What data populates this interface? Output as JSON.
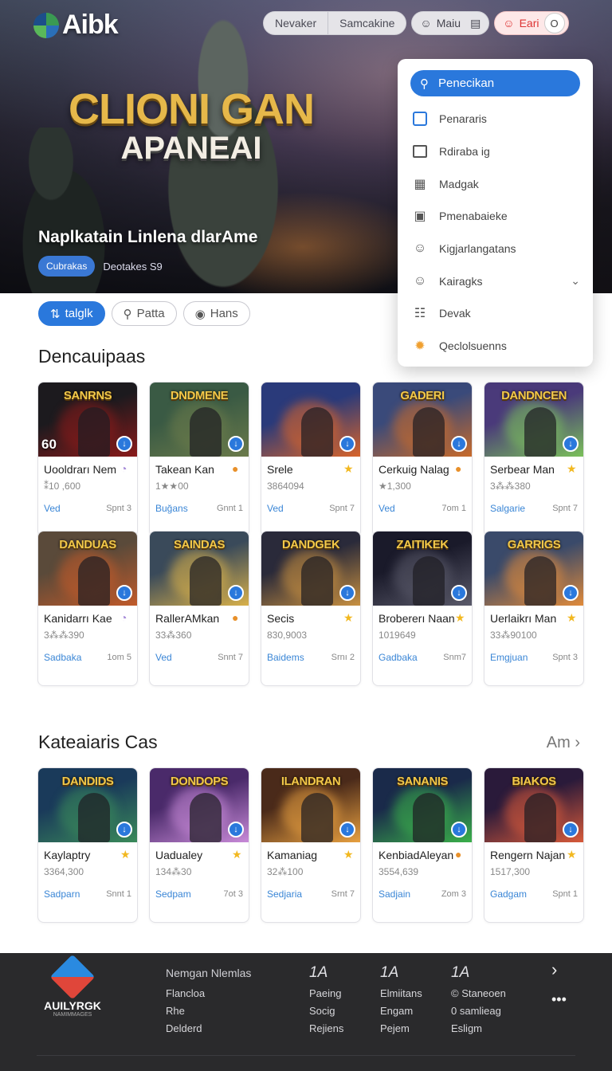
{
  "brand": {
    "name": "Aibk"
  },
  "top_nav": {
    "segment": [
      "Nevaker",
      "Samcakine"
    ],
    "user_pill": "Maiu",
    "action_pill": "Eari",
    "action_circle": "O"
  },
  "hero": {
    "title_line1": "CLIONI GAN",
    "title_line2": "APANEAI",
    "subtitle": "Naplkatain Linlena dlarAme",
    "tag": "Cubrakas",
    "meta": "Deotakes S9"
  },
  "dropdown": {
    "search": "Penecikan",
    "items": [
      {
        "label": "Penararis",
        "icon": "checkbox-icon"
      },
      {
        "label": "Rdiraba ig",
        "icon": "image-icon"
      },
      {
        "label": "Madgak",
        "icon": "grid-icon"
      },
      {
        "label": "Pmenabaieke",
        "icon": "frame-icon"
      },
      {
        "label": "Kigjarlangatans",
        "icon": "person-icon"
      },
      {
        "label": "Kairagks",
        "icon": "person-icon",
        "chevron": "⌄"
      },
      {
        "label": "Devak",
        "icon": "calendar-icon"
      },
      {
        "label": "Qeclolsuenns",
        "icon": "badge-icon"
      }
    ]
  },
  "chips": [
    "talglk",
    "Patta",
    "Hans"
  ],
  "sections": {
    "first_title": "Dencauipaas",
    "second_title": "Kateaiaris Cas",
    "second_more": "Am"
  },
  "row1": [
    {
      "logo": "SANRNS",
      "name": "Uooldrarı Nem",
      "count": "⁑10 ,600",
      "genre": "Ved",
      "date": "Spnt 3",
      "rate": "◔",
      "num": "60",
      "colors": [
        "#1c1a1e",
        "#8a1a1a"
      ]
    },
    {
      "logo": "DNDMENE",
      "name": "Takean Kan",
      "count": "1★★00",
      "genre": "Buğans",
      "date": "Gnnt 1",
      "rate": "●",
      "num": "",
      "colors": [
        "#3a5a44",
        "#6a7a4a"
      ]
    },
    {
      "logo": "",
      "name": "Srele",
      "count": "3864094",
      "genre": "Ved",
      "date": "Spnt 7",
      "rate": "★",
      "num": "",
      "colors": [
        "#2a3a7a",
        "#d8642a"
      ]
    },
    {
      "logo": "GADERI",
      "name": "Cerkuig Nalag",
      "count": "★1,300",
      "genre": "Ved",
      "date": "7om 1",
      "rate": "●",
      "num": "",
      "colors": [
        "#3a4a7a",
        "#c86a2a"
      ]
    },
    {
      "logo": "DANDNCEN",
      "name": "Serbear Man",
      "count": "3⁂⁂380",
      "genre": "Salgarie",
      "date": "Spnt 7",
      "rate": "★",
      "num": "",
      "colors": [
        "#4a3a7a",
        "#7ac05a"
      ]
    }
  ],
  "row2": [
    {
      "logo": "DANDUAS",
      "name": "Kanidarrı Kae",
      "count": "3⁂⁂390",
      "genre": "Sadbaka",
      "date": "1om 5",
      "rate": "◔",
      "num": "",
      "colors": [
        "#5a4a3a",
        "#c05a2a"
      ]
    },
    {
      "logo": "SAINDAS",
      "name": "RallerAMkan",
      "count": "33⁂360",
      "genre": "Ved",
      "date": "Snnt 7",
      "rate": "●",
      "num": "",
      "colors": [
        "#3a4a5a",
        "#d8b04a"
      ]
    },
    {
      "logo": "DANDGEK",
      "name": "Secis",
      "count": "830,9003",
      "genre": "Baidems",
      "date": "Srnı 2",
      "rate": "★",
      "num": "",
      "colors": [
        "#2a2a3a",
        "#c89040"
      ]
    },
    {
      "logo": "ZAITIKEK",
      "name": "Brobererı Naan",
      "count": "1019649",
      "genre": "Gadbaka",
      "date": "Snm7",
      "rate": "★",
      "num": "",
      "colors": [
        "#1a1a2a",
        "#5a5a6a"
      ]
    },
    {
      "logo": "GARRIGS",
      "name": "Uerlaikrı Man",
      "count": "33⁂90100",
      "genre": "Emgjuan",
      "date": "Spnt 3",
      "rate": "★",
      "num": "",
      "colors": [
        "#3a4a6a",
        "#e08a3a"
      ]
    }
  ],
  "row3": [
    {
      "logo": "DANDIDS",
      "name": "Kaylaptry",
      "count": "3364,300",
      "genre": "Sadparn",
      "date": "Snnt 1",
      "rate": "★",
      "num": "",
      "colors": [
        "#1a3a5a",
        "#3a8a5a"
      ]
    },
    {
      "logo": "DONDOPS",
      "name": "Uadualey",
      "count": "134⁂30",
      "genre": "Sedpam",
      "date": "7ot 3",
      "rate": "★",
      "num": "",
      "colors": [
        "#4a2a6a",
        "#c88ad8"
      ]
    },
    {
      "logo": "ILANDRAN",
      "name": "Kamaniag",
      "count": "32⁂100",
      "genre": "Sedjaria",
      "date": "Srnt 7",
      "rate": "★",
      "num": "",
      "colors": [
        "#4a2a1a",
        "#e8a040"
      ]
    },
    {
      "logo": "SANANIS",
      "name": "KenbiadAleyan",
      "count": "3554,639",
      "genre": "Sadjain",
      "date": "Zom 3",
      "rate": "●",
      "num": "",
      "colors": [
        "#1a2a4a",
        "#3ab04a"
      ]
    },
    {
      "logo": "BIAKOS",
      "name": "Rengern Najan",
      "count": "1517,300",
      "genre": "Gadgam",
      "date": "Spnt 1",
      "rate": "★",
      "num": "",
      "colors": [
        "#2a1a3a",
        "#d85a3a"
      ]
    }
  ],
  "footer": {
    "logo_name": "AUILYRGK",
    "logo_tag": "NAMIMMAGES",
    "col1": {
      "heading": "Nemgan Nlemlas",
      "items": [
        "Flancloa",
        "Rhe",
        "Delderd"
      ]
    },
    "col2": {
      "heading": "1A",
      "items": [
        "Paeing",
        "Socig",
        "Rejiens"
      ]
    },
    "col3": {
      "heading": "1A",
      "items": [
        "Elmiitans",
        "Engam",
        "Pejem"
      ]
    },
    "col4": {
      "heading": "1A",
      "items": [
        "© Staneoen",
        "0 samlieag",
        "Esligm"
      ]
    },
    "arrow": "›",
    "dots": "•••"
  }
}
